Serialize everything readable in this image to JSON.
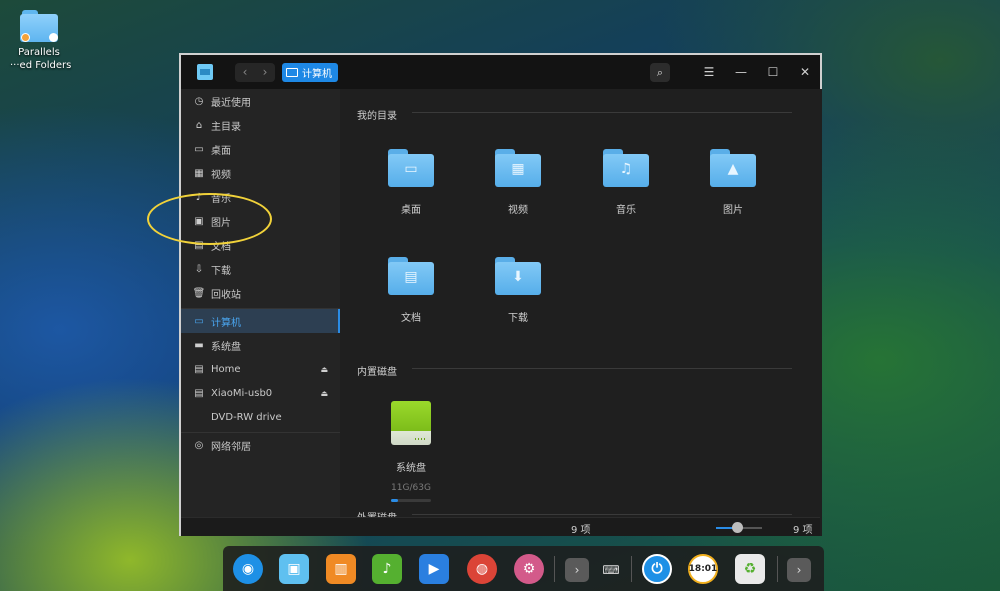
{
  "desktop": {
    "icon_label_line1": "Parallels",
    "icon_label_line2": "···ed Folders"
  },
  "window": {
    "breadcrumb": "计算机",
    "nav_back": "‹",
    "nav_forward": "›",
    "search_symbol": "⌕",
    "menu_symbol": "☰",
    "minimize_symbol": "—",
    "maximize_symbol": "☐",
    "close_symbol": "✕"
  },
  "sidebar": {
    "items": [
      {
        "label": "最近使用",
        "icon": "clock-icon",
        "glyph": "◷"
      },
      {
        "label": "主目录",
        "icon": "home-icon",
        "glyph": "⌂"
      },
      {
        "label": "桌面",
        "icon": "desktop-icon",
        "glyph": "▭"
      },
      {
        "label": "视频",
        "icon": "video-icon",
        "glyph": "▦"
      },
      {
        "label": "音乐",
        "icon": "music-icon",
        "glyph": "♪"
      },
      {
        "label": "图片",
        "icon": "picture-icon",
        "glyph": "▣"
      },
      {
        "label": "文档",
        "icon": "document-icon",
        "glyph": "▤"
      },
      {
        "label": "下载",
        "icon": "download-icon",
        "glyph": "⇩"
      },
      {
        "label": "回收站",
        "icon": "trash-icon",
        "glyph": "🗑"
      },
      {
        "label": "计算机",
        "icon": "computer-icon",
        "glyph": "▭"
      },
      {
        "label": "系统盘",
        "icon": "disk-icon",
        "glyph": "▬"
      },
      {
        "label": "Home",
        "icon": "drive-icon",
        "glyph": "▤"
      },
      {
        "label": "XiaoMi-usb0",
        "icon": "usb-drive-icon",
        "glyph": "▤"
      },
      {
        "label": "DVD-RW drive",
        "icon": "",
        "glyph": ""
      },
      {
        "label": "网络邻居",
        "icon": "network-icon",
        "glyph": "◎"
      }
    ],
    "eject_symbol": "⏏"
  },
  "main": {
    "section_my_dirs": "我的目录",
    "folders": [
      {
        "label": "桌面",
        "icon": "desktop-folder-icon",
        "glyph": "▭"
      },
      {
        "label": "视频",
        "icon": "video-folder-icon",
        "glyph": "▦"
      },
      {
        "label": "音乐",
        "icon": "music-folder-icon",
        "glyph": "♫"
      },
      {
        "label": "图片",
        "icon": "picture-folder-icon",
        "glyph": "▲"
      },
      {
        "label": "文档",
        "icon": "document-folder-icon",
        "glyph": "▤"
      },
      {
        "label": "下载",
        "icon": "download-folder-icon",
        "glyph": "⬇"
      }
    ],
    "section_internal_disks": "内置磁盘",
    "system_disk_label": "系统盘",
    "system_disk_size": "11G/63G",
    "system_disk_usage_fraction": 0.17,
    "section_external_disks": "外置磁盘"
  },
  "statusbar": {
    "item_count": "9 项",
    "item_count_right": "9 项",
    "zoom_fraction": 0.45
  },
  "dock": {
    "items": [
      {
        "icon": "launcher-icon",
        "color": "#1e90e6",
        "glyph": "◉"
      },
      {
        "icon": "file-manager-icon",
        "color": "#5fc0f0",
        "glyph": "▣"
      },
      {
        "icon": "app-store-icon",
        "color": "#f08a24",
        "glyph": "▥"
      },
      {
        "icon": "music-player-icon",
        "color": "#55b030",
        "glyph": "♪"
      },
      {
        "icon": "movie-player-icon",
        "color": "#2a7fe0",
        "glyph": "▶"
      },
      {
        "icon": "chrome-icon",
        "color": "#db4437",
        "glyph": "◍"
      },
      {
        "icon": "settings-icon",
        "color": "#d35a8a",
        "glyph": "⚙"
      }
    ],
    "tray": [
      {
        "icon": "expand-tray-icon",
        "glyph": "›"
      },
      {
        "icon": "keyboard-icon",
        "glyph": "⌨"
      },
      {
        "icon": "power-icon",
        "glyph": "⏻"
      },
      {
        "icon": "clock-widget-icon",
        "glyph": "18:01"
      },
      {
        "icon": "recycle-bin-icon",
        "glyph": "♻"
      },
      {
        "icon": "expand-dock-icon",
        "glyph": "›"
      }
    ]
  },
  "colors": {
    "accent": "#2a8ce6",
    "annotation": "#f1d23a"
  }
}
